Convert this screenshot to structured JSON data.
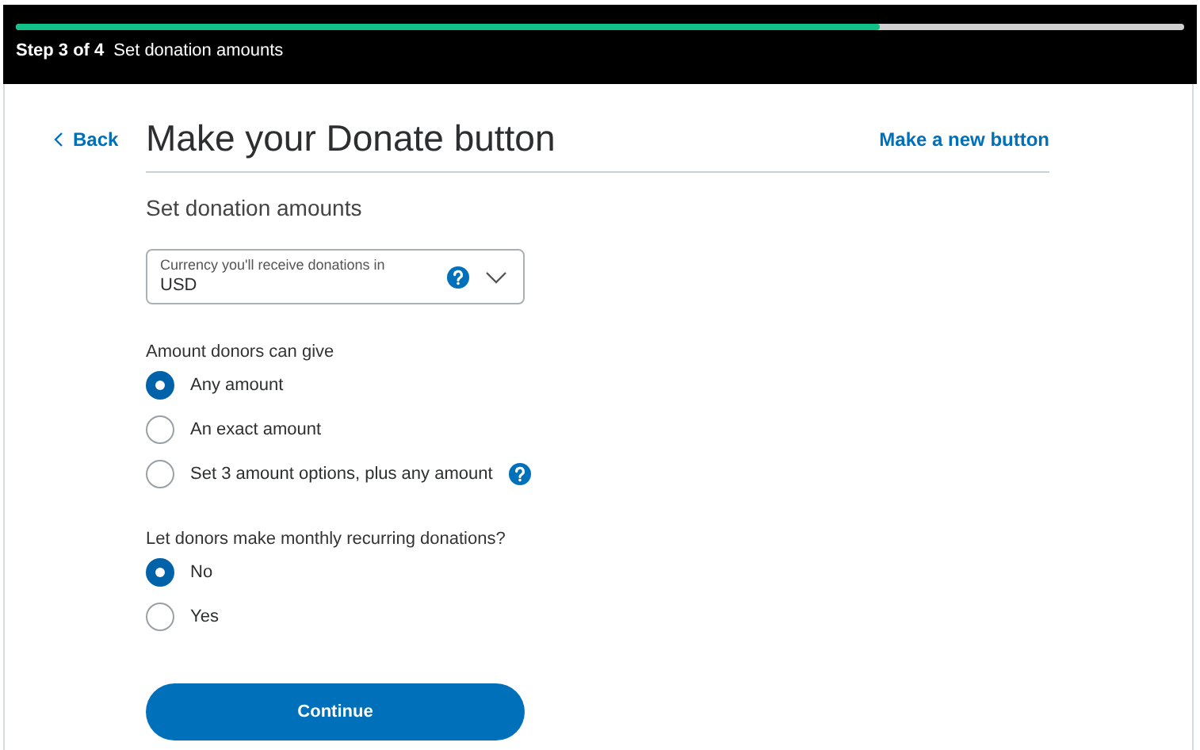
{
  "progress": {
    "level": 0.74,
    "step": "Step 3 of 4",
    "title": "Set donation amounts"
  },
  "back": "Back",
  "title": "Make your Donate button",
  "new_button_link": "Make a new button",
  "section_title": "Set donation amounts",
  "currency": {
    "label": "Currency you'll receive donations in",
    "value": "USD",
    "help": true
  },
  "groups": [
    {
      "label": "Amount donors can give",
      "options": [
        {
          "label": "Any amount",
          "selected": true,
          "help": false
        },
        {
          "label": "An exact amount",
          "selected": false,
          "help": false
        },
        {
          "label": "Set 3 amount options, plus any amount",
          "selected": false,
          "help": true
        }
      ]
    },
    {
      "label": "Let donors make monthly recurring donations?",
      "options": [
        {
          "label": "No",
          "selected": true,
          "help": false
        },
        {
          "label": "Yes",
          "selected": false,
          "help": false
        }
      ]
    }
  ],
  "continue": "Continue"
}
